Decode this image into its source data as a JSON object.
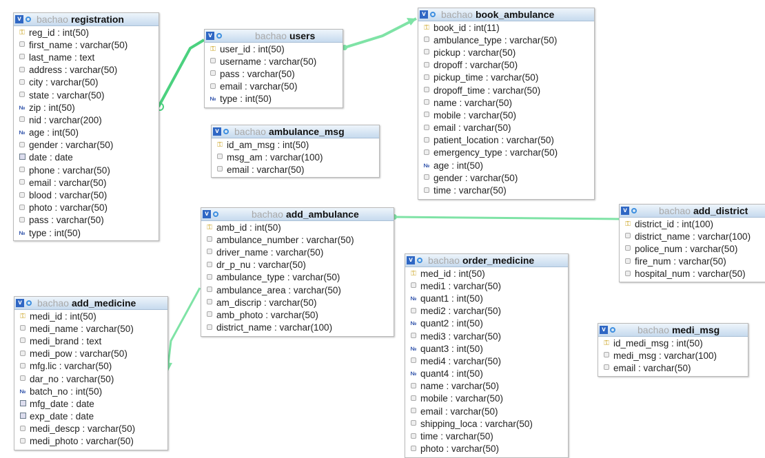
{
  "db_prefix": "bachao",
  "tables": {
    "registration": {
      "name": "registration",
      "columns": [
        {
          "text": "reg_id : int(50)",
          "kind": "key"
        },
        {
          "text": "first_name : varchar(50)",
          "kind": "col"
        },
        {
          "text": "last_name : text",
          "kind": "col"
        },
        {
          "text": "address : varchar(50)",
          "kind": "col"
        },
        {
          "text": "city : varchar(50)",
          "kind": "col"
        },
        {
          "text": "state : varchar(50)",
          "kind": "col"
        },
        {
          "text": "zip : int(50)",
          "kind": "num"
        },
        {
          "text": "nid : varchar(200)",
          "kind": "col"
        },
        {
          "text": "age : int(50)",
          "kind": "num"
        },
        {
          "text": "gender : varchar(50)",
          "kind": "col"
        },
        {
          "text": "date : date",
          "kind": "date"
        },
        {
          "text": "phone : varchar(50)",
          "kind": "col"
        },
        {
          "text": "email : varchar(50)",
          "kind": "col"
        },
        {
          "text": "blood : varchar(50)",
          "kind": "col"
        },
        {
          "text": "photo : varchar(50)",
          "kind": "col"
        },
        {
          "text": "pass : varchar(50)",
          "kind": "col"
        },
        {
          "text": "type : int(50)",
          "kind": "num"
        }
      ]
    },
    "users": {
      "name": "users",
      "columns": [
        {
          "text": "user_id : int(50)",
          "kind": "key"
        },
        {
          "text": "username : varchar(50)",
          "kind": "col"
        },
        {
          "text": "pass : varchar(50)",
          "kind": "col"
        },
        {
          "text": "email : varchar(50)",
          "kind": "col"
        },
        {
          "text": "type : int(50)",
          "kind": "num"
        }
      ]
    },
    "book_ambulance": {
      "name": "book_ambulance",
      "columns": [
        {
          "text": "book_id : int(11)",
          "kind": "key"
        },
        {
          "text": "ambulance_type : varchar(50)",
          "kind": "col"
        },
        {
          "text": "pickup : varchar(50)",
          "kind": "col"
        },
        {
          "text": "dropoff : varchar(50)",
          "kind": "col"
        },
        {
          "text": "pickup_time : varchar(50)",
          "kind": "col"
        },
        {
          "text": "dropoff_time : varchar(50)",
          "kind": "col"
        },
        {
          "text": "name : varchar(50)",
          "kind": "col"
        },
        {
          "text": "mobile : varchar(50)",
          "kind": "col"
        },
        {
          "text": "email : varchar(50)",
          "kind": "col"
        },
        {
          "text": "patient_location : varchar(50)",
          "kind": "col"
        },
        {
          "text": "emergency_type : varchar(50)",
          "kind": "col"
        },
        {
          "text": "age : int(50)",
          "kind": "num"
        },
        {
          "text": "gender : varchar(50)",
          "kind": "col"
        },
        {
          "text": "time : varchar(50)",
          "kind": "col"
        }
      ]
    },
    "ambulance_msg": {
      "name": "ambulance_msg",
      "columns": [
        {
          "text": "id_am_msg : int(50)",
          "kind": "key"
        },
        {
          "text": "msg_am : varchar(100)",
          "kind": "col"
        },
        {
          "text": "email : varchar(50)",
          "kind": "col"
        }
      ]
    },
    "add_ambulance": {
      "name": "add_ambulance",
      "columns": [
        {
          "text": "amb_id : int(50)",
          "kind": "key"
        },
        {
          "text": "ambulance_number : varchar(50)",
          "kind": "col"
        },
        {
          "text": "driver_name : varchar(50)",
          "kind": "col"
        },
        {
          "text": "dr_p_nu : varchar(50)",
          "kind": "col"
        },
        {
          "text": "ambulance_type : varchar(50)",
          "kind": "col"
        },
        {
          "text": "ambulance_area : varchar(50)",
          "kind": "col"
        },
        {
          "text": "am_discrip : varchar(50)",
          "kind": "col"
        },
        {
          "text": "amb_photo : varchar(50)",
          "kind": "col"
        },
        {
          "text": "district_name : varchar(100)",
          "kind": "col"
        }
      ]
    },
    "add_district": {
      "name": "add_district",
      "columns": [
        {
          "text": "district_id : int(100)",
          "kind": "key"
        },
        {
          "text": "district_name : varchar(100)",
          "kind": "col"
        },
        {
          "text": "police_num : varchar(50)",
          "kind": "col"
        },
        {
          "text": "fire_num : varchar(50)",
          "kind": "col"
        },
        {
          "text": "hospital_num : varchar(50)",
          "kind": "col"
        }
      ]
    },
    "order_medicine": {
      "name": "order_medicine",
      "columns": [
        {
          "text": "med_id : int(50)",
          "kind": "key"
        },
        {
          "text": "medi1 : varchar(50)",
          "kind": "col"
        },
        {
          "text": "quant1 : int(50)",
          "kind": "num"
        },
        {
          "text": "medi2 : varchar(50)",
          "kind": "col"
        },
        {
          "text": "quant2 : int(50)",
          "kind": "num"
        },
        {
          "text": "medi3 : varchar(50)",
          "kind": "col"
        },
        {
          "text": "quant3 : int(50)",
          "kind": "num"
        },
        {
          "text": "medi4 : varchar(50)",
          "kind": "col"
        },
        {
          "text": "quant4 : int(50)",
          "kind": "num"
        },
        {
          "text": "name : varchar(50)",
          "kind": "col"
        },
        {
          "text": "mobile : varchar(50)",
          "kind": "col"
        },
        {
          "text": "email : varchar(50)",
          "kind": "col"
        },
        {
          "text": "shipping_loca : varchar(50)",
          "kind": "col"
        },
        {
          "text": "time : varchar(50)",
          "kind": "col"
        },
        {
          "text": "photo : varchar(50)",
          "kind": "col"
        }
      ]
    },
    "add_medicine": {
      "name": "add_medicine",
      "columns": [
        {
          "text": "medi_id : int(50)",
          "kind": "key"
        },
        {
          "text": "medi_name : varchar(50)",
          "kind": "col"
        },
        {
          "text": "medi_brand : text",
          "kind": "col"
        },
        {
          "text": "medi_pow : varchar(50)",
          "kind": "col"
        },
        {
          "text": "mfg.lic : varchar(50)",
          "kind": "col"
        },
        {
          "text": "dar_no : varchar(50)",
          "kind": "col"
        },
        {
          "text": "batch_no : int(50)",
          "kind": "num"
        },
        {
          "text": "mfg_date : date",
          "kind": "date"
        },
        {
          "text": "exp_date : date",
          "kind": "date"
        },
        {
          "text": "medi_descp : varchar(50)",
          "kind": "col"
        },
        {
          "text": "medi_photo : varchar(50)",
          "kind": "col"
        }
      ]
    },
    "medi_msg": {
      "name": "medi_msg",
      "columns": [
        {
          "text": "id_medi_msg : int(50)",
          "kind": "key"
        },
        {
          "text": "medi_msg : varchar(100)",
          "kind": "col"
        },
        {
          "text": "email : varchar(50)",
          "kind": "col"
        }
      ]
    }
  },
  "relations": [
    {
      "from": "registration",
      "to": "users"
    },
    {
      "from": "users",
      "to": "book_ambulance"
    },
    {
      "from": "add_ambulance",
      "to": "add_district"
    },
    {
      "from": "add_ambulance",
      "to": "add_medicine"
    }
  ],
  "colors": {
    "link": "#7fe3a6",
    "link_dark": "#4bd17f",
    "header": "#c6daee",
    "key_icon": "#c9a11b",
    "num_icon": "#2b4ea8"
  },
  "icons": {
    "header": [
      "v-icon",
      "options-icon"
    ],
    "key": "key-icon",
    "column": "column-icon",
    "numeric": "numeric-icon",
    "date": "date-icon"
  }
}
